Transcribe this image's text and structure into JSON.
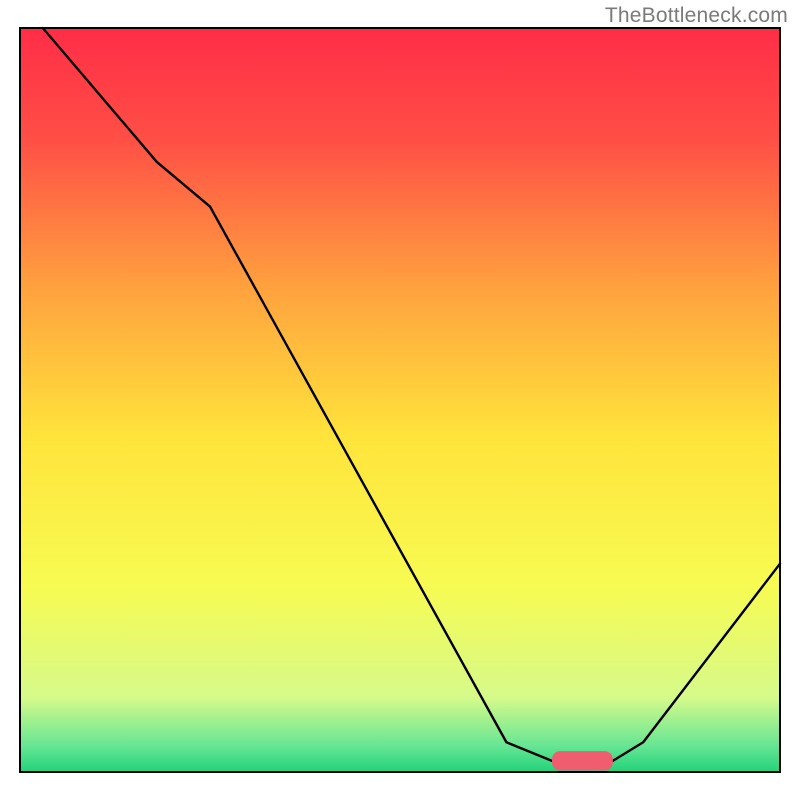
{
  "watermark": "TheBottleneck.com",
  "chart_data": {
    "type": "line",
    "title": "",
    "xlabel": "",
    "ylabel": "",
    "xlim": [
      0,
      100
    ],
    "ylim": [
      0,
      100
    ],
    "grid": false,
    "legend": false,
    "background_gradient": {
      "orientation": "vertical",
      "stops": [
        {
          "offset": 0.0,
          "color": "#ff2d47"
        },
        {
          "offset": 0.15,
          "color": "#ff4f46"
        },
        {
          "offset": 0.35,
          "color": "#ffa23e"
        },
        {
          "offset": 0.55,
          "color": "#ffe43b"
        },
        {
          "offset": 0.75,
          "color": "#f7fb52"
        },
        {
          "offset": 0.9,
          "color": "#d6fa8a"
        },
        {
          "offset": 0.965,
          "color": "#66e694"
        },
        {
          "offset": 1.0,
          "color": "#22d27a"
        }
      ]
    },
    "series": [
      {
        "name": "bottleneck-curve",
        "color": "#000000",
        "points": [
          {
            "x": 3,
            "y": 100
          },
          {
            "x": 18,
            "y": 82
          },
          {
            "x": 25,
            "y": 76
          },
          {
            "x": 64,
            "y": 4
          },
          {
            "x": 70,
            "y": 1.5
          },
          {
            "x": 78,
            "y": 1.5
          },
          {
            "x": 82,
            "y": 4
          },
          {
            "x": 100,
            "y": 28
          }
        ]
      }
    ],
    "marker": {
      "name": "optimal-range",
      "color": "#ef5d6e",
      "x_start": 70,
      "x_end": 78,
      "y": 1.5,
      "thickness": 2.6
    }
  }
}
